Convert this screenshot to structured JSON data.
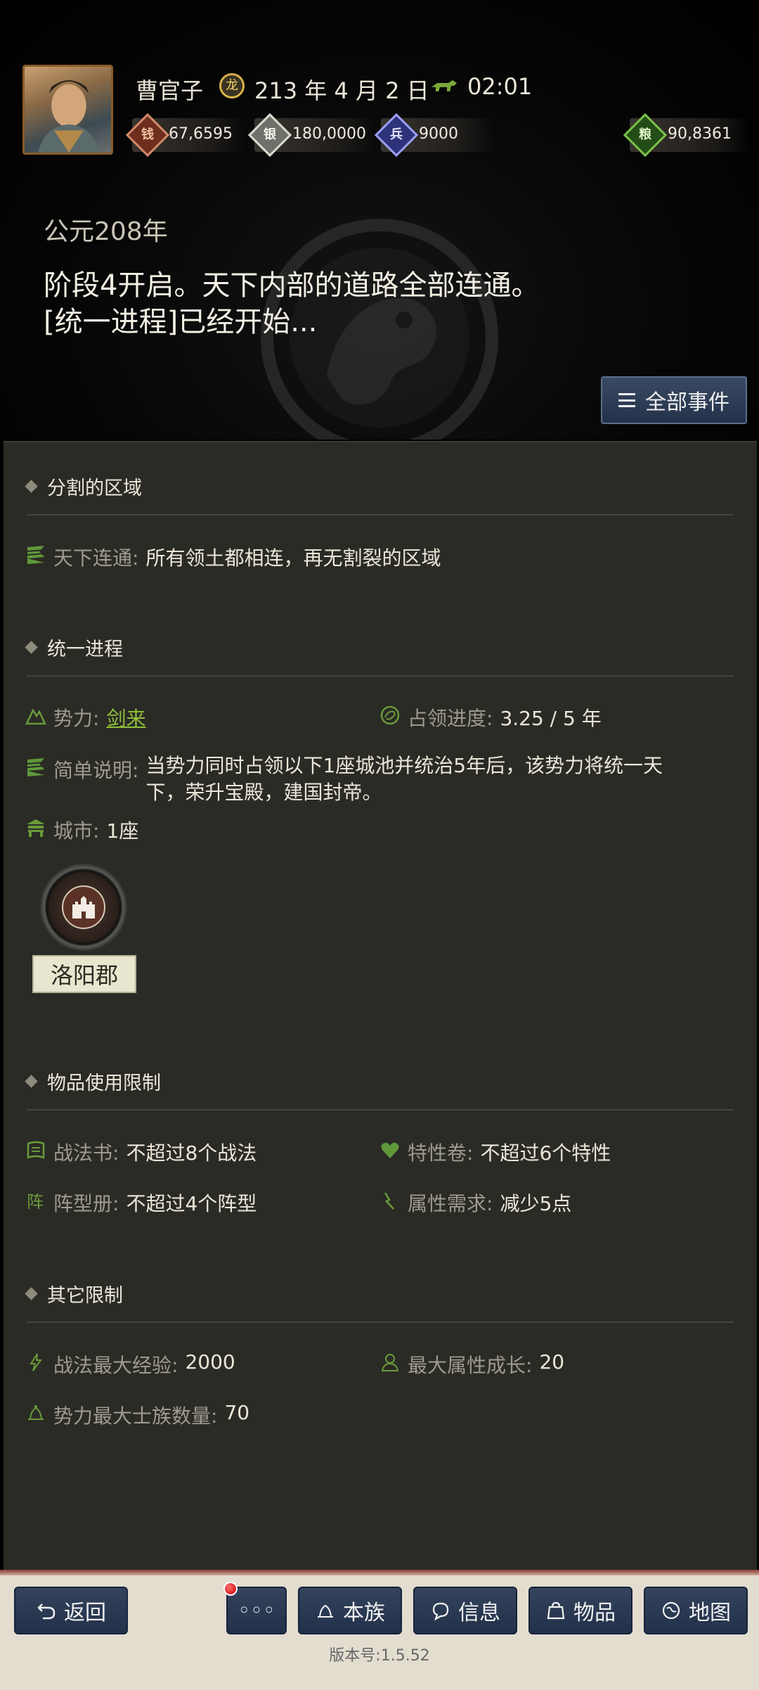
{
  "header": {
    "player_name": "曹官子",
    "date": "213 年 4 月 2 日",
    "time": "02:01",
    "date_icon_glyph": "龙",
    "resources": [
      {
        "name": "copper-coin",
        "value": "67,6595",
        "color": "#b5573a",
        "glyph": "钱"
      },
      {
        "name": "silver",
        "value": "180,0000",
        "color": "#a9b2a2",
        "glyph": "银"
      },
      {
        "name": "troops",
        "value": "9000",
        "color": "#5a5fb0",
        "glyph": "兵"
      },
      {
        "name": "food",
        "value": "90,8361",
        "color": "#3f8a2a",
        "glyph": "粮"
      }
    ]
  },
  "event": {
    "year": "公元208年",
    "line1": "阶段4开启。天下内部的道路全部连通。",
    "line2": "[统一进程]已经开始...",
    "all_events_label": "全部事件"
  },
  "sections": {
    "divided": {
      "title": "分割的区域",
      "label": "天下连通:",
      "value": "所有领土都相连，再无割裂的区域"
    },
    "unification": {
      "title": "统一进程",
      "force_label": "势力:",
      "force_value": "剑来",
      "progress_label": "占领进度:",
      "progress_value": "3.25 / 5 年",
      "progress_fraction": 0.65,
      "desc_label": "简单说明:",
      "desc_value": "当势力同时占领以下1座城池并统治5年后，该势力将统一天下，荣升宝殿，建国封帝。",
      "city_label": "城市:",
      "city_value": "1座",
      "city_name": "洛阳郡"
    },
    "items": {
      "title": "物品使用限制",
      "tactics_label": "战法书:",
      "tactics_value": "不超过8个战法",
      "trait_label": "特性卷:",
      "trait_value": "不超过6个特性",
      "formation_label": "阵型册:",
      "formation_value": "不超过4个阵型",
      "attr_label": "属性需求:",
      "attr_value": "减少5点"
    },
    "other": {
      "title": "其它限制",
      "exp_label": "战法最大经验:",
      "exp_value": "2000",
      "growth_label": "最大属性成长:",
      "growth_value": "20",
      "clan_label": "势力最大士族数量:",
      "clan_value": "70"
    }
  },
  "nav": {
    "back": "返回",
    "more": "◦◦◦",
    "clan": "本族",
    "info": "信息",
    "items": "物品",
    "map": "地图"
  },
  "version": "版本号:1.5.52",
  "colors": {
    "accent_green": "#8fbf3a",
    "panel_bg": "#2b2b26",
    "button_blue": "#2b3a54"
  }
}
